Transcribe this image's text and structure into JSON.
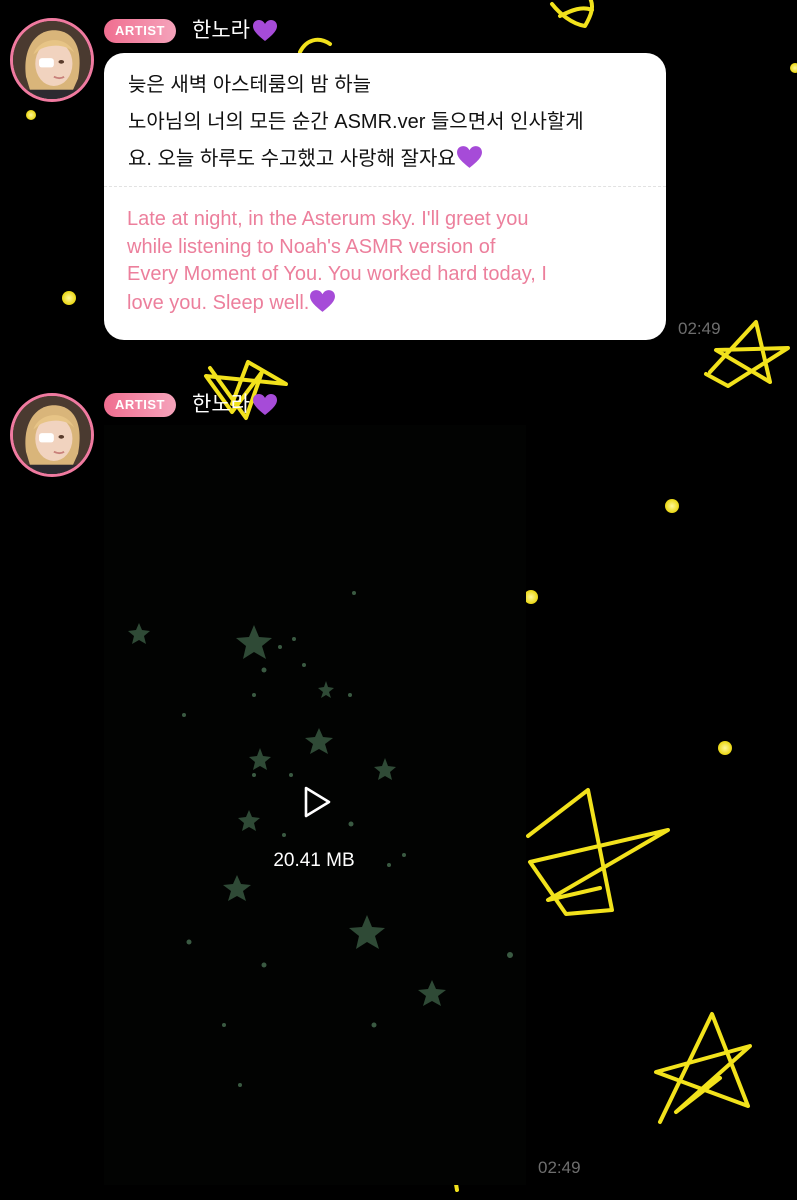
{
  "messages": [
    {
      "badge": "ARTIST",
      "sender": "한노라",
      "text_ko_line1": "늦은 새벽 아스테룸의 밤 하늘",
      "text_ko_line2": "노아님의 너의 모든 순간 ASMR.ver 들으면서 인사할게",
      "text_ko_line3": "요. 오늘 하루도 수고했고 사랑해 잘자요",
      "translation_line1": "Late at night, in the Asterum sky. I'll greet you",
      "translation_line2": "while listening to Noah's ASMR version of",
      "translation_line3": "Every Moment of You. You worked hard today, I",
      "translation_line4": "love you. Sleep well.",
      "time": "02:49",
      "emoji": "purple-heart"
    },
    {
      "badge": "ARTIST",
      "sender": "한노라",
      "video_size": "20.41 MB",
      "time": "02:49",
      "emoji": "purple-heart"
    }
  ],
  "colors": {
    "background": "#000000",
    "badge_start": "#f06e90",
    "badge_end": "#f5a3bb",
    "avatar_ring": "#f07aa0",
    "translation_text": "#ec7f9c",
    "timestamp": "#6e6e6e",
    "star_doodle": "#f5e52a",
    "heart": "#a64bd8"
  },
  "icons": [
    "play-icon",
    "purple-heart-icon",
    "star-doodle-icon",
    "avatar-image"
  ]
}
